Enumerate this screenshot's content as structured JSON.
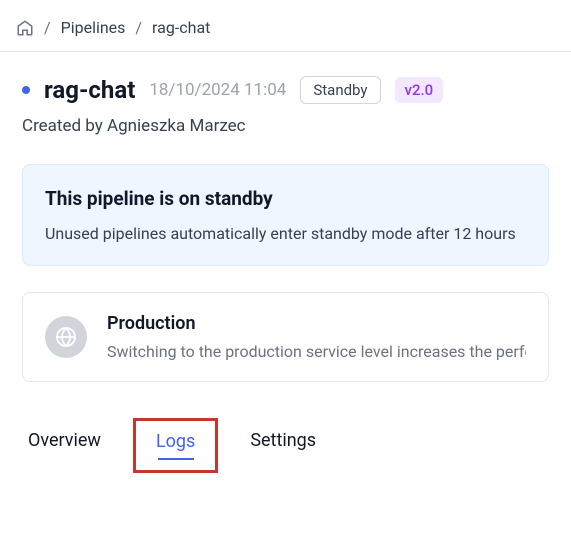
{
  "breadcrumbs": {
    "pipelines": "Pipelines",
    "current": "rag-chat"
  },
  "header": {
    "title": "rag-chat",
    "timestamp": "18/10/2024 11:04",
    "status": "Standby",
    "version": "v2.0"
  },
  "created_by": "Created by Agnieszka Marzec",
  "banner": {
    "title": "This pipeline is on standby",
    "desc": "Unused pipelines automatically enter standby mode after 12 hours"
  },
  "production": {
    "title": "Production",
    "desc": "Switching to the production service level increases the performance"
  },
  "tabs": {
    "overview": "Overview",
    "logs": "Logs",
    "settings": "Settings"
  }
}
